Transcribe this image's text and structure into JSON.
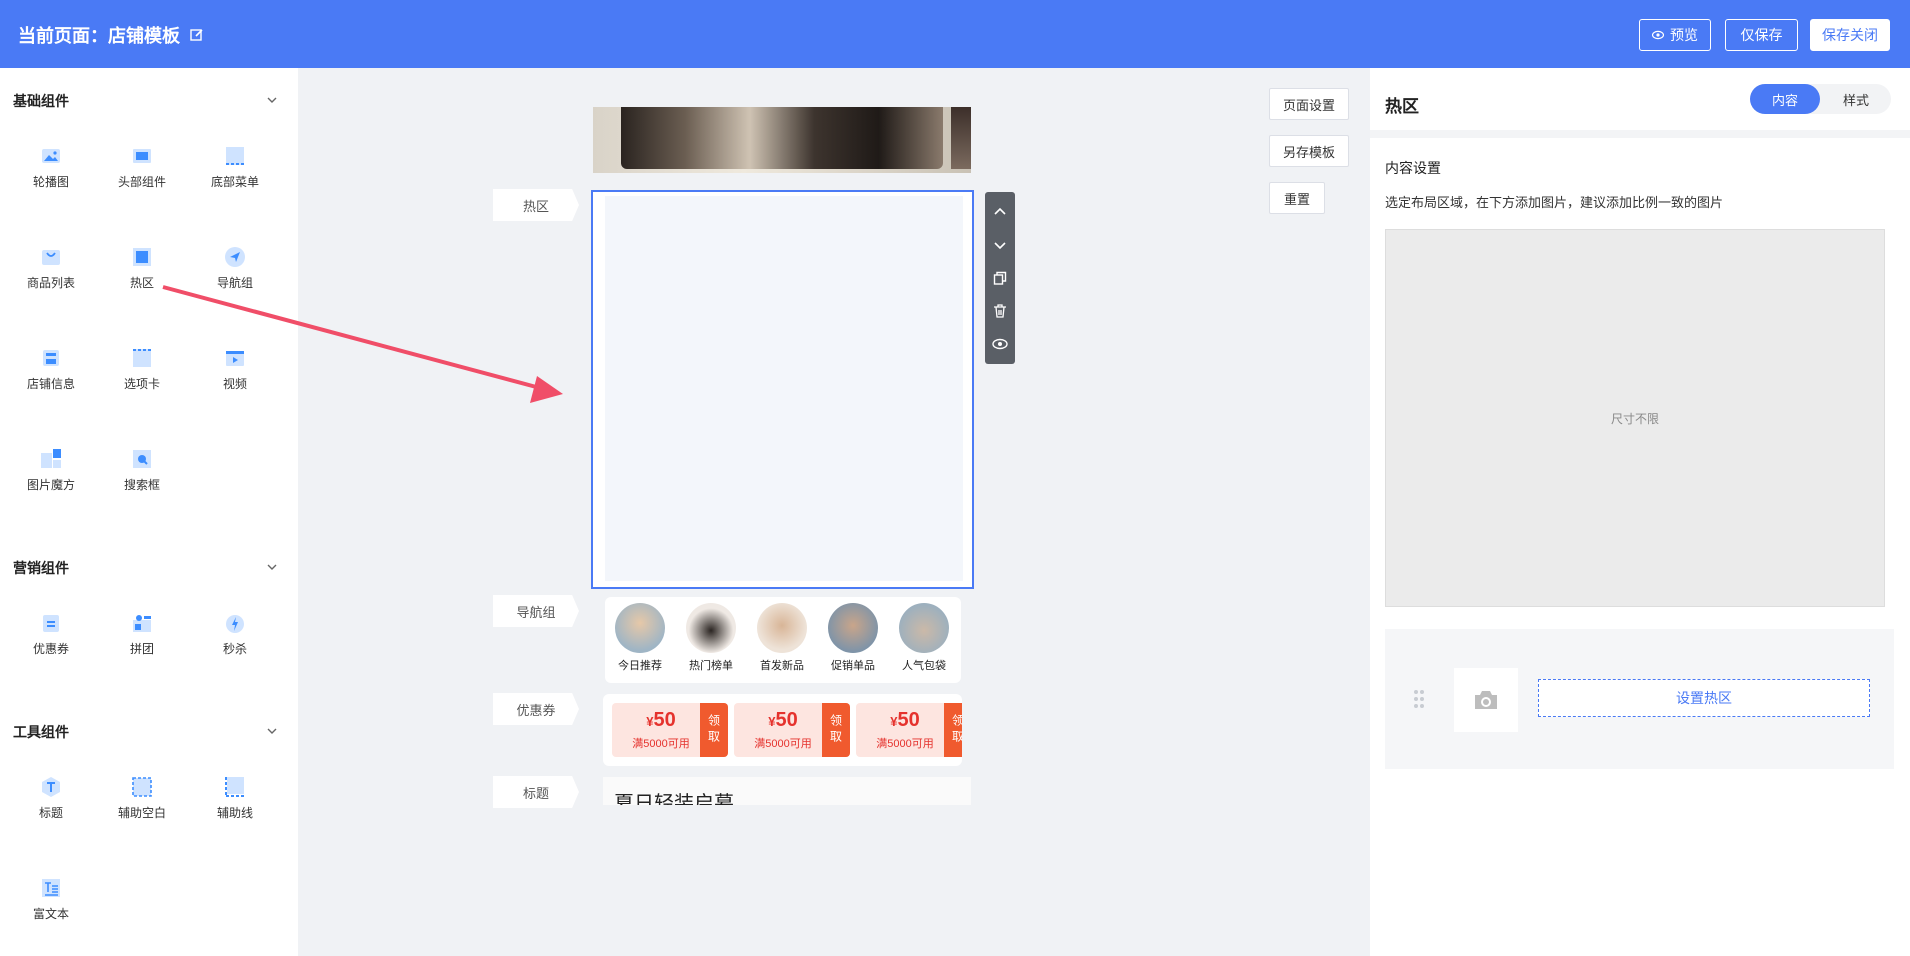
{
  "header": {
    "title": "当前页面：店铺模板",
    "preview_label": "预览",
    "save_label": "仅保存",
    "save_close_label": "保存关闭"
  },
  "sidebar": {
    "groups": [
      {
        "title": "基础组件",
        "items": [
          {
            "label": "轮播图",
            "icon": "image-icon"
          },
          {
            "label": "头部组件",
            "icon": "header-icon"
          },
          {
            "label": "底部菜单",
            "icon": "footer-menu-icon"
          },
          {
            "label": "商品列表",
            "icon": "shopping-bag-icon"
          },
          {
            "label": "热区",
            "icon": "hotzone-icon"
          },
          {
            "label": "导航组",
            "icon": "navigation-icon"
          },
          {
            "label": "店铺信息",
            "icon": "store-icon"
          },
          {
            "label": "选项卡",
            "icon": "tab-icon"
          },
          {
            "label": "视频",
            "icon": "video-icon"
          },
          {
            "label": "图片魔方",
            "icon": "image-cube-icon"
          },
          {
            "label": "搜索框",
            "icon": "search-icon"
          }
        ]
      },
      {
        "title": "营销组件",
        "items": [
          {
            "label": "优惠券",
            "icon": "coupon-icon"
          },
          {
            "label": "拼团",
            "icon": "group-buy-icon"
          },
          {
            "label": "秒杀",
            "icon": "flash-sale-icon"
          }
        ]
      },
      {
        "title": "工具组件",
        "items": [
          {
            "label": "标题",
            "icon": "title-icon"
          },
          {
            "label": "辅助空白",
            "icon": "blank-icon"
          },
          {
            "label": "辅助线",
            "icon": "divider-line-icon"
          },
          {
            "label": "富文本",
            "icon": "rich-text-icon"
          }
        ]
      }
    ]
  },
  "canvas": {
    "page_settings_label": "页面设置",
    "save_template_label": "另存模板",
    "reset_label": "重置",
    "tags": {
      "hotzone": "热区",
      "nav": "导航组",
      "coupon": "优惠券",
      "title": "标题"
    },
    "nav_items": [
      {
        "label": "今日推荐"
      },
      {
        "label": "热门榜单"
      },
      {
        "label": "首发新品"
      },
      {
        "label": "促销单品"
      },
      {
        "label": "人气包袋"
      }
    ],
    "coupons": [
      {
        "currency": "¥",
        "amount": "50",
        "condition": "满5000可用",
        "take": "领取"
      },
      {
        "currency": "¥",
        "amount": "50",
        "condition": "满5000可用",
        "take": "领取"
      },
      {
        "currency": "¥",
        "amount": "50",
        "condition": "满5000可用",
        "take": "领取"
      }
    ],
    "title_text": "夏日轻装启幕"
  },
  "right_panel": {
    "title": "热区",
    "tab_content": "内容",
    "tab_style": "样式",
    "section_title": "内容设置",
    "description": "选定布局区域，在下方添加图片，建议添加比例一致的图片",
    "preview_placeholder": "尺寸不限",
    "set_hotzone_label": "设置热区"
  },
  "colors": {
    "primary": "#4a7af5",
    "coupon_red": "#e5322d",
    "coupon_take": "#f05a2e",
    "arrow": "#f04e68"
  }
}
